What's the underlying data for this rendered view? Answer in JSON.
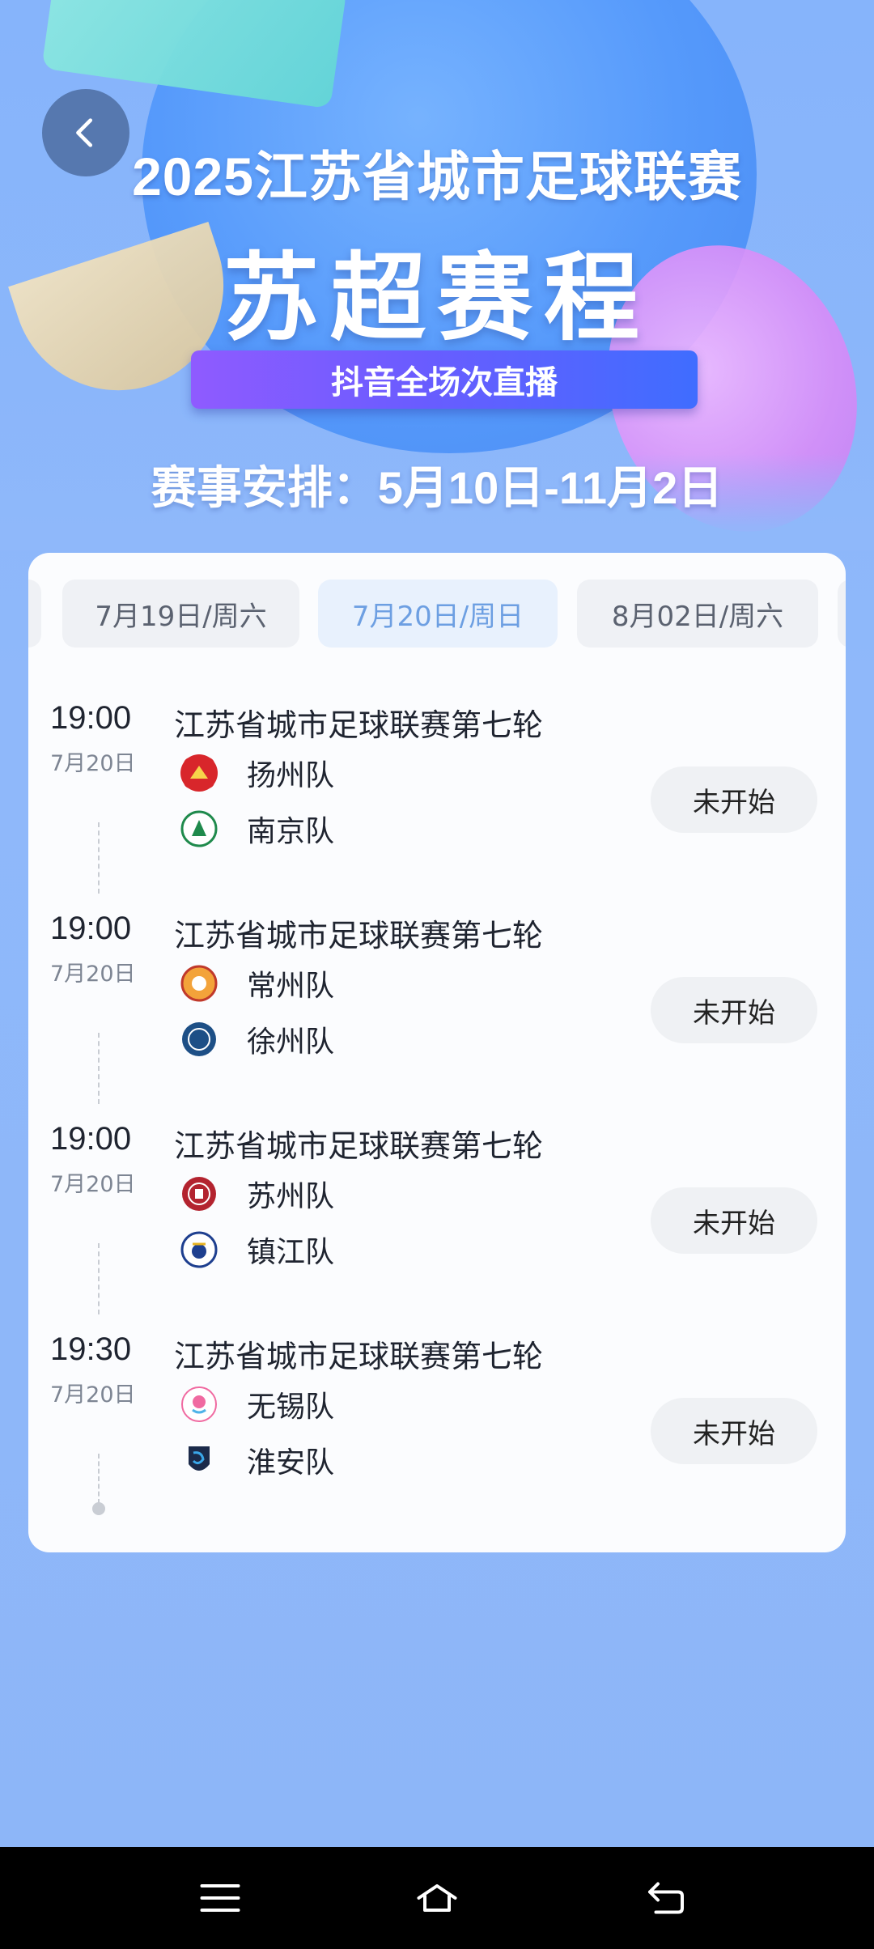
{
  "header": {
    "title_line1": "2025江苏省城市足球联赛",
    "title_line2": "苏超赛程",
    "live_badge": "抖音全场次直播",
    "schedule_range": "赛事安排：5月10日-11月2日"
  },
  "date_tabs": [
    {
      "label": "7月19日/周六",
      "active": false
    },
    {
      "label": "7月20日/周日",
      "active": true
    },
    {
      "label": "8月02日/周六",
      "active": false
    }
  ],
  "matches": [
    {
      "time": "19:00",
      "date": "7月20日",
      "title": "江苏省城市足球联赛第七轮",
      "home": {
        "name": "扬州队",
        "logo": "yangzhou-logo-icon"
      },
      "away": {
        "name": "南京队",
        "logo": "nanjing-logo-icon"
      },
      "status": "未开始"
    },
    {
      "time": "19:00",
      "date": "7月20日",
      "title": "江苏省城市足球联赛第七轮",
      "home": {
        "name": "常州队",
        "logo": "changzhou-logo-icon"
      },
      "away": {
        "name": "徐州队",
        "logo": "xuzhou-logo-icon"
      },
      "status": "未开始"
    },
    {
      "time": "19:00",
      "date": "7月20日",
      "title": "江苏省城市足球联赛第七轮",
      "home": {
        "name": "苏州队",
        "logo": "suzhou-logo-icon"
      },
      "away": {
        "name": "镇江队",
        "logo": "zhenjiang-logo-icon"
      },
      "status": "未开始"
    },
    {
      "time": "19:30",
      "date": "7月20日",
      "title": "江苏省城市足球联赛第七轮",
      "home": {
        "name": "无锡队",
        "logo": "wuxi-logo-icon"
      },
      "away": {
        "name": "淮安队",
        "logo": "huaian-logo-icon"
      },
      "status": "未开始"
    }
  ],
  "colors": {
    "background": "#8fb8fa",
    "active_tab_text": "#6d9fe2",
    "live_badge_start": "#8f5bff",
    "live_badge_end": "#3f6dff"
  },
  "icons": {
    "back": "chevron-left-icon",
    "nav_menu": "menu-icon",
    "nav_home": "home-icon",
    "nav_back": "back-arrow-icon"
  }
}
